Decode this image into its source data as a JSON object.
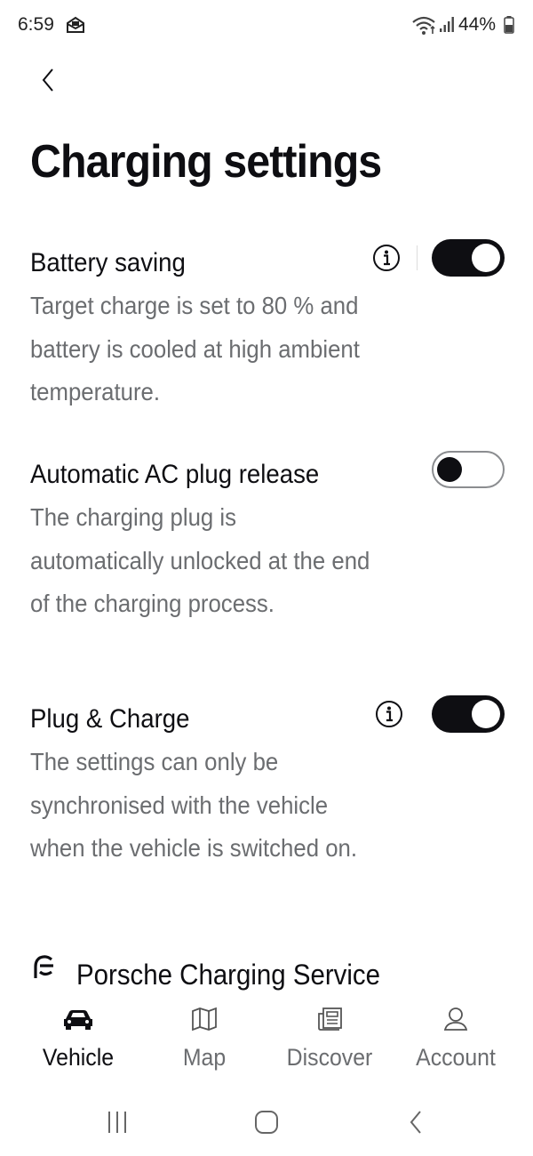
{
  "status_bar": {
    "time": "6:59",
    "battery_percent": "44%",
    "icons": [
      "mail-icon",
      "wifi-icon",
      "signal-icon",
      "battery-icon"
    ]
  },
  "header": {
    "back_icon": "chevron-left-icon",
    "title": "Charging settings"
  },
  "settings": [
    {
      "title": "Battery saving",
      "description": "Target charge is set to 80 % and battery is cooled at high ambient temperature.",
      "has_info": true,
      "enabled": true
    },
    {
      "title": "Automatic AC plug release",
      "description": "The charging plug is automatically unlocked at the end of the charging process.",
      "has_info": false,
      "enabled": false
    },
    {
      "title": "Plug & Charge",
      "description": "The settings can only be synchronised with the vehicle when the vehicle is switched on.",
      "has_info": true,
      "enabled": true
    }
  ],
  "service": {
    "icon": "charging-service-icon",
    "label": "Porsche Charging Service"
  },
  "bottom_nav": {
    "items": [
      {
        "label": "Vehicle",
        "icon": "car-icon",
        "active": true
      },
      {
        "label": "Map",
        "icon": "map-icon",
        "active": false
      },
      {
        "label": "Discover",
        "icon": "news-icon",
        "active": false
      },
      {
        "label": "Account",
        "icon": "user-icon",
        "active": false
      }
    ]
  },
  "system_nav": {
    "icons": [
      "recents-icon",
      "home-icon",
      "back-icon"
    ]
  },
  "colors": {
    "text_primary": "#0e0e12",
    "text_secondary": "#6b6d70",
    "toggle_on": "#0e0e12",
    "background": "#ffffff"
  }
}
